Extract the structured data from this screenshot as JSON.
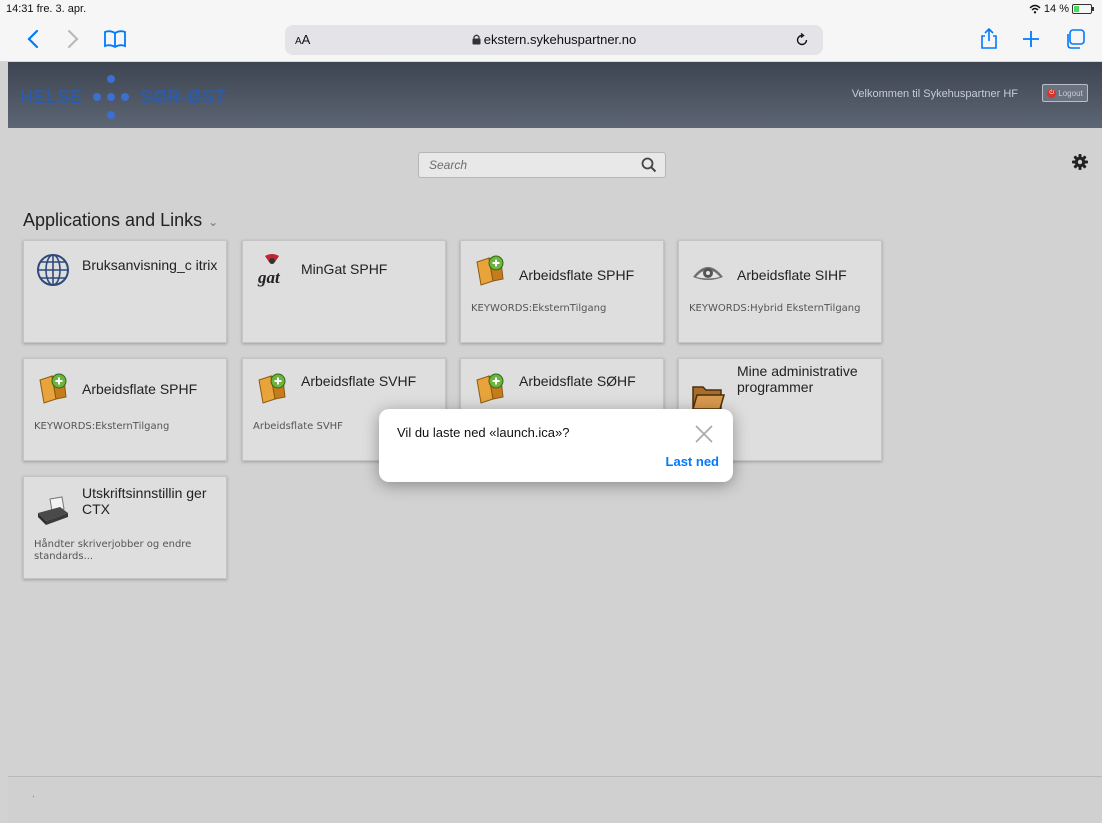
{
  "status_bar": {
    "time": "14:31",
    "date": "fre. 3. apr.",
    "battery": "14 %"
  },
  "browser": {
    "aa_small": "A",
    "aa_large": "A",
    "url": "ekstern.sykehuspartner.no"
  },
  "header": {
    "logo_left": "HELSE",
    "logo_right": "SØR-ØST",
    "welcome": "Velkommen til Sykehuspartner HF",
    "logout_label": "Logout"
  },
  "search": {
    "placeholder": "Search"
  },
  "section_title": "Applications and Links",
  "section_chevron": "⌄",
  "tiles": [
    {
      "name": "Bruksanvisning_c itrix",
      "subtitle": "",
      "icon": "globe-icon"
    },
    {
      "name": "MinGat SPHF",
      "subtitle": "",
      "icon": "gat-logo-icon"
    },
    {
      "name": "Arbeidsflate SPHF",
      "subtitle": "KEYWORDS:EksternTilgang",
      "icon": "citrix-app-icon"
    },
    {
      "name": "Arbeidsflate SIHF",
      "subtitle": "KEYWORDS:Hybrid EksternTilgang",
      "icon": "eye-logo-icon"
    },
    {
      "name": "Arbeidsflate SPHF",
      "subtitle": "KEYWORDS:EksternTilgang",
      "icon": "citrix-app-icon"
    },
    {
      "name": "Arbeidsflate SVHF",
      "subtitle": "Arbeidsflate SVHF",
      "icon": "citrix-app-icon"
    },
    {
      "name": "Arbeidsflate SØHF",
      "subtitle": "",
      "icon": "citrix-app-icon"
    },
    {
      "name": "Mine administrative programmer",
      "subtitle": "",
      "icon": "folder-icon"
    },
    {
      "name": "Utskriftsinnstillin ger CTX",
      "subtitle": "Håndter skriverjobber og endre standards...",
      "icon": "printer-icon"
    }
  ],
  "dialog": {
    "message": "Vil du laste ned «launch.ica»?",
    "action": "Last ned"
  },
  "footer": {
    "text": "."
  },
  "colors": {
    "accent": "#007aff",
    "logo_blue": "#2c5ca8",
    "header_bg": "#4a5260",
    "page_bg": "#d2d2d2"
  }
}
